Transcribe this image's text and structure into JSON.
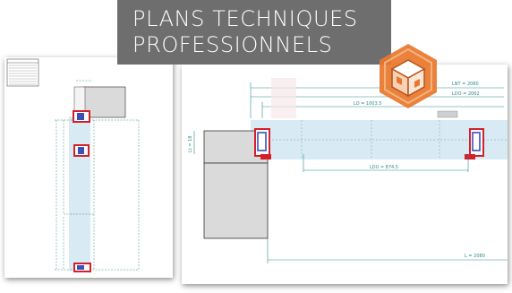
{
  "banner": {
    "line1": "PLANS TECHNIQUES",
    "line2": "PROFESSIONNELS",
    "background": "#6e6e6e",
    "text_color": "#ffffff"
  },
  "logo": {
    "icon": "orange-hexagon-box-icon",
    "color": "#e8772e"
  },
  "right_drawing": {
    "dimensions": {
      "lnt": "LNT = 2080",
      "ldo": "LDO = 2062",
      "lo": "LO = 1003.5",
      "ldu": "LDU = 874.5",
      "l": "L = 2080",
      "vertical": "Lt = 18"
    }
  },
  "colors": {
    "profile_red": "#d4202a",
    "profile_blue": "#3b4fb8",
    "glass": "#d8eaf3",
    "dimension_line": "#2e8a8a",
    "wall_grey": "#dadada"
  }
}
